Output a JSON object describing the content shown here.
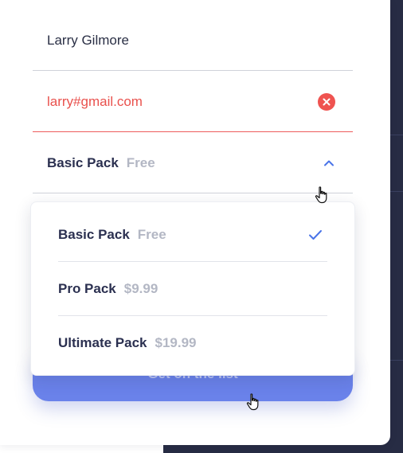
{
  "form": {
    "name_value": "Larry Gilmore",
    "email_value": "larry#gmail.com",
    "plan_select": {
      "name": "Basic Pack",
      "price": "Free"
    },
    "submit_label": "Get on the list"
  },
  "dropdown": {
    "options": [
      {
        "name": "Basic Pack",
        "price": "Free",
        "selected": true
      },
      {
        "name": "Pro Pack",
        "price": "$9.99",
        "selected": false
      },
      {
        "name": "Ultimate Pack",
        "price": "$19.99",
        "selected": false
      }
    ]
  },
  "colors": {
    "accent": "#4a74e8",
    "error": "#ef5350",
    "button": "#6a82ea",
    "sidebar": "#272c44"
  },
  "icons": [
    "error-icon",
    "chevron-up-icon",
    "checkmark-icon",
    "pointer-cursor-icon"
  ]
}
